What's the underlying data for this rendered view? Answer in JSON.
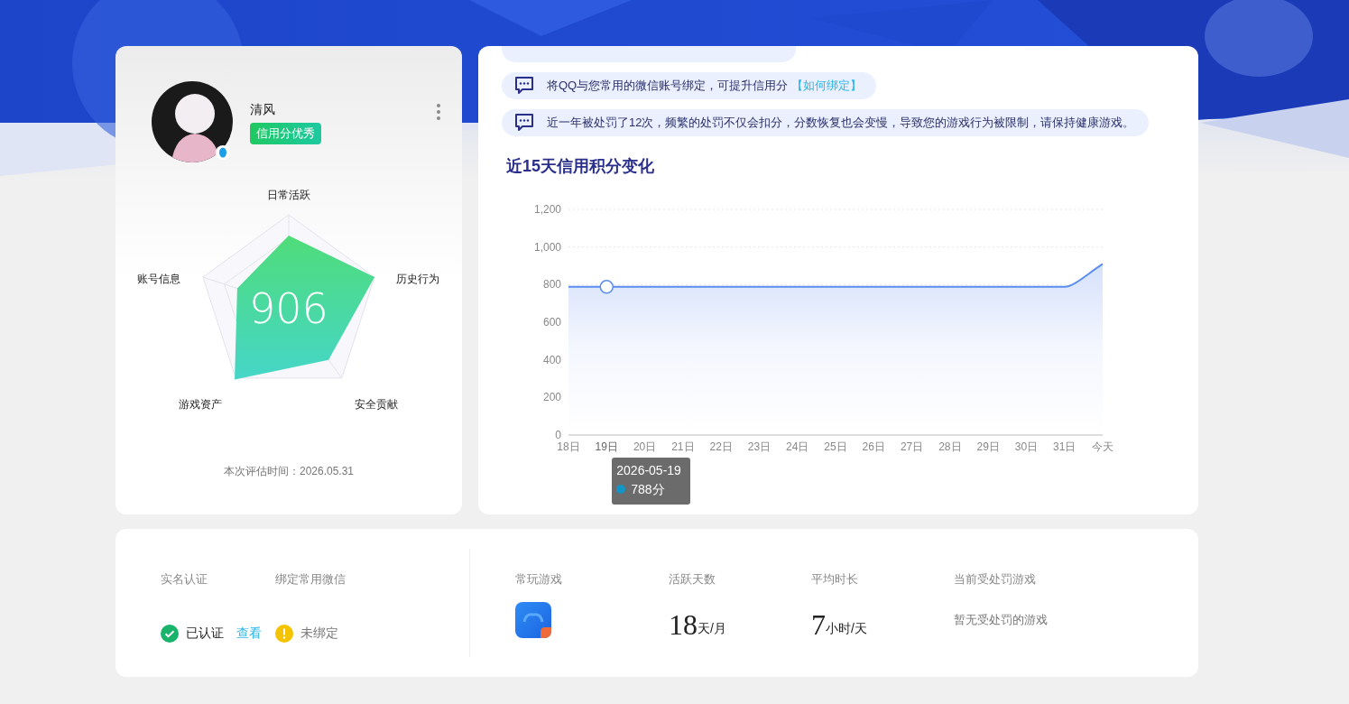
{
  "profile": {
    "name": "清风",
    "badge": "信用分优秀",
    "score": "906",
    "radar_labels": [
      "日常活跃",
      "历史行为",
      "安全贡献",
      "游戏资产",
      "账号信息"
    ],
    "evaluated": "本次评估时间：2026.05.31"
  },
  "notices": [
    {
      "text": "将QQ与您常用的微信账号绑定，可提升信用分",
      "link": "【如何绑定】"
    },
    {
      "text": "近一年被处罚了12次，频繁的处罚不仅会扣分，分数恢复也会变慢，导致您的游戏行为被限制，请保持健康游戏。"
    }
  ],
  "chart": {
    "title": "近15天信用积分变化",
    "chart_data": {
      "type": "area",
      "categories": [
        "18日",
        "19日",
        "20日",
        "21日",
        "22日",
        "23日",
        "24日",
        "25日",
        "26日",
        "27日",
        "28日",
        "29日",
        "30日",
        "31日",
        "今天"
      ],
      "series": [
        {
          "color": "#5b8def",
          "values": [
            788,
            788,
            788,
            788,
            788,
            788,
            788,
            788,
            788,
            788,
            788,
            788,
            788,
            788,
            910
          ]
        }
      ],
      "ylim": [
        0,
        1200
      ],
      "yticks": [
        0,
        200,
        400,
        600,
        800,
        {
          "value": 1000,
          "label": "1,000"
        },
        {
          "value": 1200,
          "label": "1,200"
        }
      ]
    },
    "points": [
      {
        "selected": false
      },
      {
        "selected": true
      },
      {
        "selected": false
      },
      {
        "selected": false
      },
      {
        "selected": false
      },
      {
        "selected": false
      },
      {
        "selected": false
      },
      {
        "selected": false
      },
      {
        "selected": false
      },
      {
        "selected": false
      },
      {
        "selected": false
      },
      {
        "selected": false
      },
      {
        "selected": false
      },
      {
        "selected": false
      },
      {
        "selected": false
      }
    ],
    "tooltip": {
      "date": "2026-05-19",
      "value": "788分"
    }
  },
  "account": [
    {
      "label": "实名认证",
      "kind": "verified",
      "status": "已认证",
      "link": "查看"
    },
    {
      "label": "绑定常用微信",
      "kind": "warning",
      "status": "未绑定"
    }
  ],
  "stats": [
    {
      "label": "常玩游戏",
      "kind": "game"
    },
    {
      "label": "活跃天数",
      "kind": "number",
      "value": "18",
      "unit": "天/月"
    },
    {
      "label": "平均时长",
      "kind": "number",
      "value": "7",
      "unit": "小时/天"
    },
    {
      "label": "当前受处罚游戏",
      "kind": "text",
      "value": "暂无受处罚的游戏"
    }
  ]
}
